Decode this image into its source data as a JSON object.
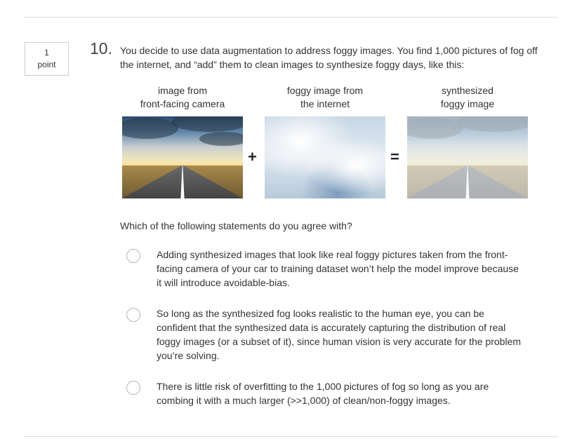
{
  "question": {
    "points_value": "1",
    "points_label": "point",
    "number": "10.",
    "text": "You decide to use data augmentation to address foggy images. You find 1,000 pictures of fog off the internet, and “add” them to clean images to synthesize foggy days, like this:"
  },
  "figure": {
    "captions": [
      "image from\nfront-facing camera",
      "foggy image from\nthe internet",
      "synthesized\nfoggy image"
    ],
    "plus": "+",
    "equals": "="
  },
  "prompt": "Which of the following statements do you agree with?",
  "options": [
    {
      "text": "Adding synthesized images that look like real foggy pictures taken from the front-facing camera of your car to training dataset won’t help the model improve because it will introduce avoidable-bias."
    },
    {
      "text": "So long as the synthesized fog looks realistic to the human eye, you can be confident that the synthesized data is accurately capturing the distribution of real foggy images (or a subset of it), since human vision is very accurate for the problem you’re solving."
    },
    {
      "text": "There is little risk of overfitting to the 1,000 pictures of fog so long as you are combing it with a much larger (>>1,000) of clean/non-foggy images."
    }
  ]
}
